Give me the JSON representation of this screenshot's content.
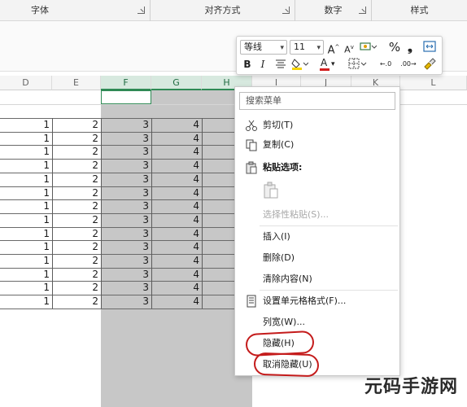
{
  "ribbon": {
    "groups": [
      "字体",
      "对齐方式",
      "数字",
      "样式"
    ]
  },
  "sheet": {
    "columns": [
      "D",
      "E",
      "F",
      "G",
      "H",
      "I",
      "J",
      "K",
      "L"
    ],
    "selected_columns": [
      "F",
      "G",
      "H"
    ],
    "rows": [
      [
        "1",
        "2",
        "3",
        "4"
      ],
      [
        "1",
        "2",
        "3",
        "4"
      ],
      [
        "1",
        "2",
        "3",
        "4"
      ],
      [
        "1",
        "2",
        "3",
        "4"
      ],
      [
        "1",
        "2",
        "3",
        "4"
      ],
      [
        "1",
        "2",
        "3",
        "4"
      ],
      [
        "1",
        "2",
        "3",
        "4"
      ],
      [
        "1",
        "2",
        "3",
        "4"
      ],
      [
        "1",
        "2",
        "3",
        "4"
      ],
      [
        "1",
        "2",
        "3",
        "4"
      ],
      [
        "1",
        "2",
        "3",
        "4"
      ],
      [
        "1",
        "2",
        "3",
        "4"
      ],
      [
        "1",
        "2",
        "3",
        "4"
      ],
      [
        "1",
        "2",
        "3",
        "4"
      ]
    ]
  },
  "mini_toolbar": {
    "font_name": "等线",
    "font_size": "11",
    "grow_font": "A",
    "shrink_font": "A",
    "percent": "%",
    "comma": "❟",
    "bold": "B",
    "italic": "I",
    "font_color_letter": "A",
    "decimal_increase": "←.0",
    "decimal_decrease": ".00→"
  },
  "context_menu": {
    "search_placeholder": "搜索菜单",
    "cut": "剪切(T)",
    "copy": "复制(C)",
    "paste_options": "粘贴选项:",
    "paste_special": "选择性粘贴(S)...",
    "insert": "插入(I)",
    "delete": "删除(D)",
    "clear_contents": "清除内容(N)",
    "format_cells": "设置单元格格式(F)...",
    "column_width": "列宽(W)...",
    "hide": "隐藏(H)",
    "unhide": "取消隐藏(U)"
  },
  "watermark": "元码手游网",
  "colors": {
    "selection_fill": "#c7c7c7",
    "selected_header": "#d7e9df",
    "accent_green": "#2f8a55",
    "annotation_red": "#c41b1b",
    "font_color_bar": "#d21e1e",
    "highlight_bar": "#f5d400"
  }
}
